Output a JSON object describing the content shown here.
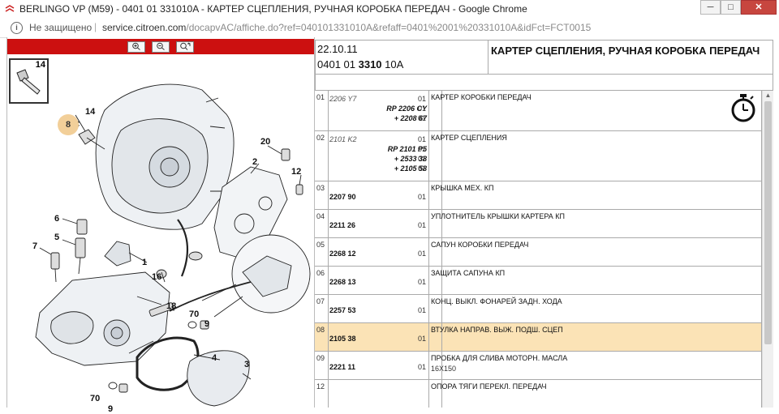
{
  "window": {
    "title": "BERLINGO VP (M59) - 0401 01 331010A - КАРТЕР СЦЕПЛЕНИЯ, РУЧНАЯ КОРОБКА ПЕРЕДАЧ - Google Chrome",
    "minimize_glyph": "─",
    "maximize_glyph": "□",
    "close_glyph": "✕"
  },
  "address_bar": {
    "security_text": "Не защищено",
    "separator": "|",
    "host": "service.citroen.com",
    "path": "/docapvAC/affiche.do?ref=040101331010A&refaff=0401%2001%20331010A&idFct=FCT0015"
  },
  "toolbar": {
    "zoom_in_icon": "zoom-in-icon",
    "zoom_out_icon": "zoom-out-icon",
    "fit_icon": "zoom-fit-icon"
  },
  "diagram": {
    "thumb_label": "14",
    "highlight_label": "8",
    "callouts": [
      "14",
      "8",
      "20",
      "2",
      "12",
      "6",
      "5",
      "7",
      "1",
      "16",
      "18",
      "70",
      "9",
      "4",
      "3",
      "70",
      "9"
    ]
  },
  "header": {
    "date": "22.10.11",
    "code_prefix": "0401 01 ",
    "code_bold": "3310",
    "code_suffix": " 10A",
    "title": "КАРТЕР СЦЕПЛЕНИЯ, РУЧНАЯ КОРОБКА ПЕРЕДАЧ"
  },
  "rows": [
    {
      "idx": "01",
      "refs": [
        {
          "t": "2206 Y7",
          "style": "it"
        },
        {
          "t": "RP 2206 CY",
          "style": "r"
        },
        {
          "t": "+ 2208 67",
          "style": "r"
        }
      ],
      "qty": [
        "01",
        "01",
        "01"
      ],
      "desc": "КАРТЕР КОРОБКИ ПЕРЕДАЧ",
      "sub": ""
    },
    {
      "idx": "02",
      "refs": [
        {
          "t": "2101 K2",
          "style": "it"
        },
        {
          "t": "RP 2101 P5",
          "style": "r"
        },
        {
          "t": "+ 2533 38",
          "style": "r"
        },
        {
          "t": "+ 2105 58",
          "style": "r"
        }
      ],
      "qty": [
        "01",
        "01",
        "01",
        "01"
      ],
      "desc": "КАРТЕР СЦЕПЛЕНИЯ",
      "sub": ""
    },
    {
      "idx": "03",
      "refs": [
        {
          "t": "2207 90",
          "style": ""
        }
      ],
      "qty": [
        "01"
      ],
      "desc": "КРЫШКА МЕХ. КП",
      "sub": ""
    },
    {
      "idx": "04",
      "refs": [
        {
          "t": "2211 26",
          "style": ""
        }
      ],
      "qty": [
        "01"
      ],
      "desc": "УПЛОТНИТЕЛЬ КРЫШКИ КАРТЕРА КП",
      "sub": ""
    },
    {
      "idx": "05",
      "refs": [
        {
          "t": "2268 12",
          "style": ""
        }
      ],
      "qty": [
        "01"
      ],
      "desc": "САПУН КОРОБКИ ПЕРЕДАЧ",
      "sub": ""
    },
    {
      "idx": "06",
      "refs": [
        {
          "t": "2268 13",
          "style": ""
        }
      ],
      "qty": [
        "01"
      ],
      "desc": "ЗАЩИТА САПУНА КП",
      "sub": ""
    },
    {
      "idx": "07",
      "refs": [
        {
          "t": "2257 53",
          "style": ""
        }
      ],
      "qty": [
        "01"
      ],
      "desc": "КОНЦ. ВЫКЛ. ФОНАРЕЙ ЗАДН. ХОДА",
      "sub": ""
    },
    {
      "idx": "08",
      "refs": [
        {
          "t": "2105 38",
          "style": ""
        }
      ],
      "qty": [
        "01"
      ],
      "desc": "ВТУЛКА НАПРАВ. ВЫЖ. ПОДШ. СЦЕП",
      "sub": "",
      "selected": true
    },
    {
      "idx": "09",
      "refs": [
        {
          "t": "2221 11",
          "style": ""
        }
      ],
      "qty": [
        "01"
      ],
      "desc": "ПРОБКА ДЛЯ СЛИВА МОТОРН. МАСЛА",
      "sub": "16X150"
    },
    {
      "idx": "12",
      "refs": [],
      "qty": [],
      "desc": "ОПОРА ТЯГИ ПЕРЕКЛ. ПЕРЕДАЧ",
      "sub": ""
    }
  ],
  "colors": {
    "red_bar": "#cc1010",
    "selected_row": "#fbe3b6",
    "highlight_badge": "#f2cf99"
  }
}
